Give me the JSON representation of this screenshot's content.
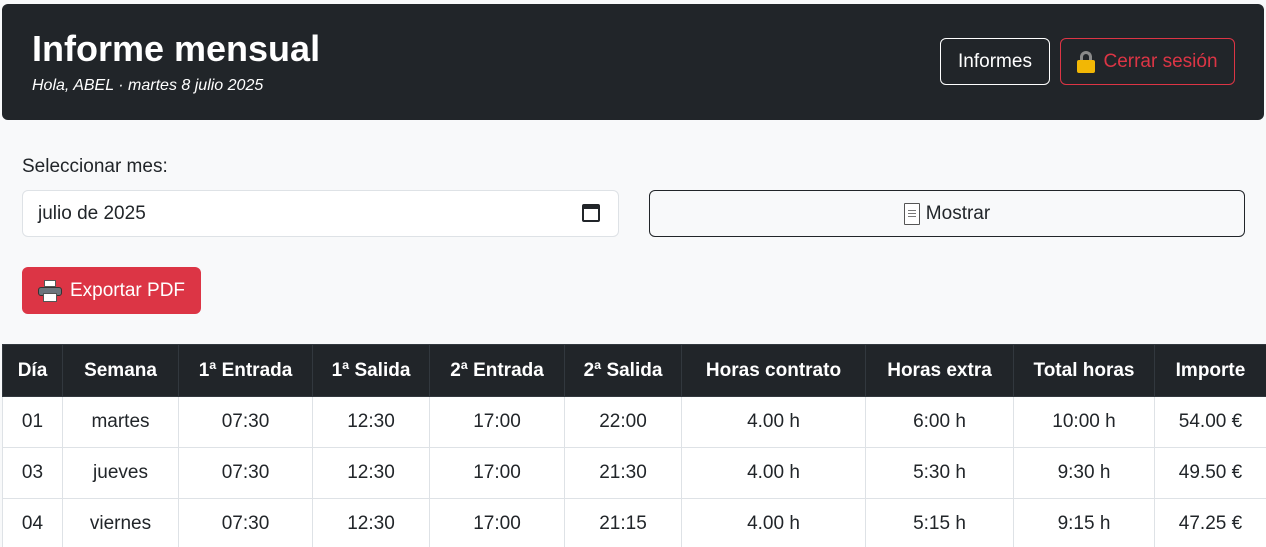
{
  "header": {
    "title": "Informe mensual",
    "subtitle": "Hola, ABEL · martes 8 julio 2025",
    "informes_label": "Informes",
    "logout_label": "Cerrar sesión"
  },
  "form": {
    "month_label": "Seleccionar mes:",
    "month_value": "julio de 2025",
    "show_label": "Mostrar",
    "export_label": "Exportar PDF"
  },
  "icons": {
    "logout": "lock-icon",
    "month": "calendar-icon",
    "show": "document-icon",
    "export": "printer-icon"
  },
  "colors": {
    "header_bg": "#212529",
    "danger": "#dc3545",
    "page_bg": "#f8f9fa"
  },
  "table": {
    "columns": [
      "Día",
      "Semana",
      "1ª Entrada",
      "1ª Salida",
      "2ª Entrada",
      "2ª Salida",
      "Horas contrato",
      "Horas extra",
      "Total horas",
      "Importe"
    ],
    "rows": [
      [
        "01",
        "martes",
        "07:30",
        "12:30",
        "17:00",
        "22:00",
        "4.00 h",
        "6:00 h",
        "10:00 h",
        "54.00 €"
      ],
      [
        "03",
        "jueves",
        "07:30",
        "12:30",
        "17:00",
        "21:30",
        "4.00 h",
        "5:30 h",
        "9:30 h",
        "49.50 €"
      ],
      [
        "04",
        "viernes",
        "07:30",
        "12:30",
        "17:00",
        "21:15",
        "4.00 h",
        "5:15 h",
        "9:15 h",
        "47.25 €"
      ]
    ]
  }
}
